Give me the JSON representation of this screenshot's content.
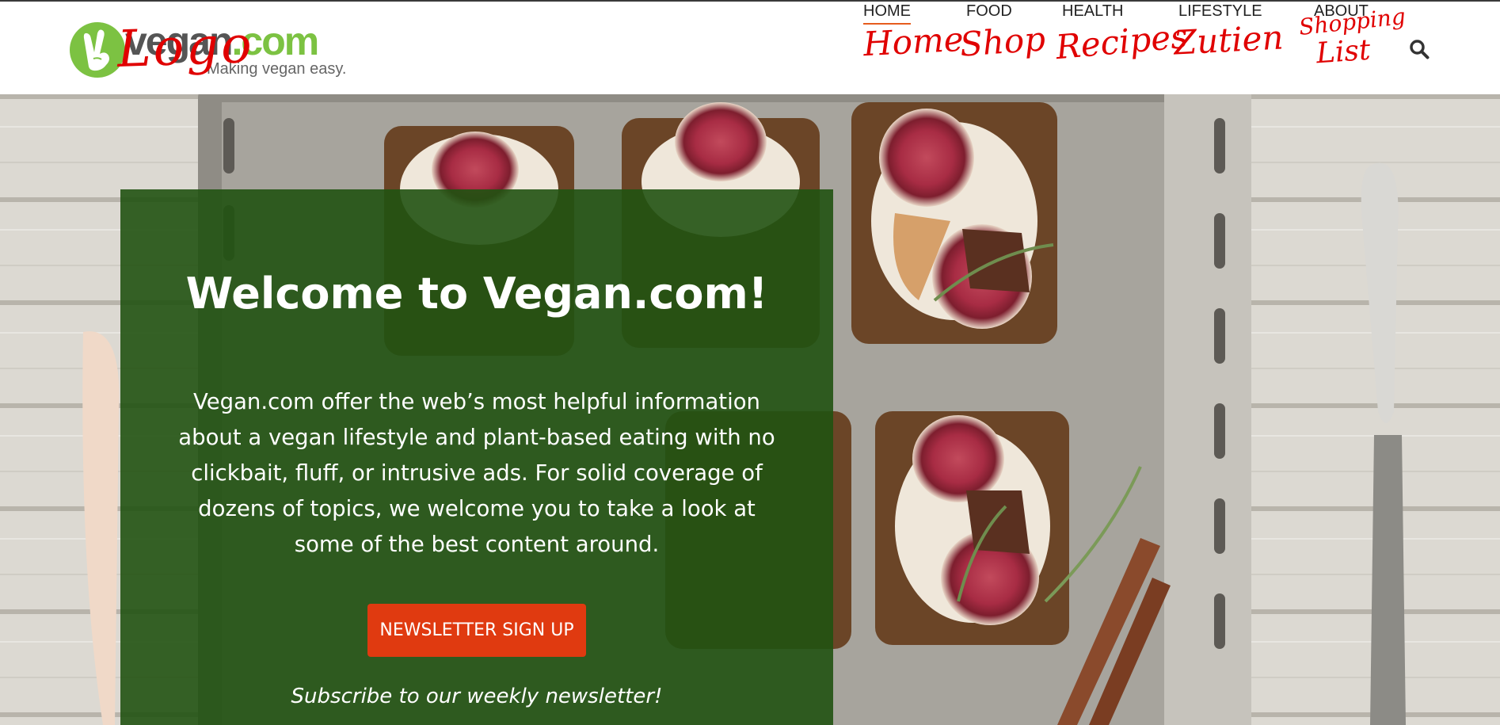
{
  "header": {
    "logo": {
      "wordmark_main": "vegan",
      "wordmark_tld": ".com",
      "tagline": "Making vegan easy.",
      "mark_icon": "peace-hand-icon",
      "brand_green": "#7cc242"
    },
    "nav": {
      "items": [
        {
          "label": "HOME",
          "active": true
        },
        {
          "label": "FOOD",
          "active": false
        },
        {
          "label": "HEALTH",
          "active": false
        },
        {
          "label": "LIFESTYLE",
          "active": false
        },
        {
          "label": "ABOUT",
          "active": false
        }
      ],
      "search_icon": "search-icon",
      "active_underline_color": "#e65c1e"
    },
    "annotations": {
      "logo": "Logo",
      "home": "Home",
      "shop": "Shop",
      "recipes": "Recipes",
      "zutien": "Zutien",
      "shopping_1": "Shopping",
      "shopping_2": "List",
      "ink_color": "#e00000"
    }
  },
  "hero": {
    "title": "Welcome to Vegan.com!",
    "body": "Vegan.com offer the web’s most helpful information about a vegan lifestyle and plant-based eating with no clickbait, fluff, or intrusive ads. For solid coverage of dozens of topics, we welcome you to take a look at some of the best content around.",
    "cta_label": "NEWSLETTER SIGN UP",
    "cta_color": "#e03a10",
    "subscribe_note": "Subscribe to our weekly newsletter!",
    "card_color": "#215212"
  }
}
